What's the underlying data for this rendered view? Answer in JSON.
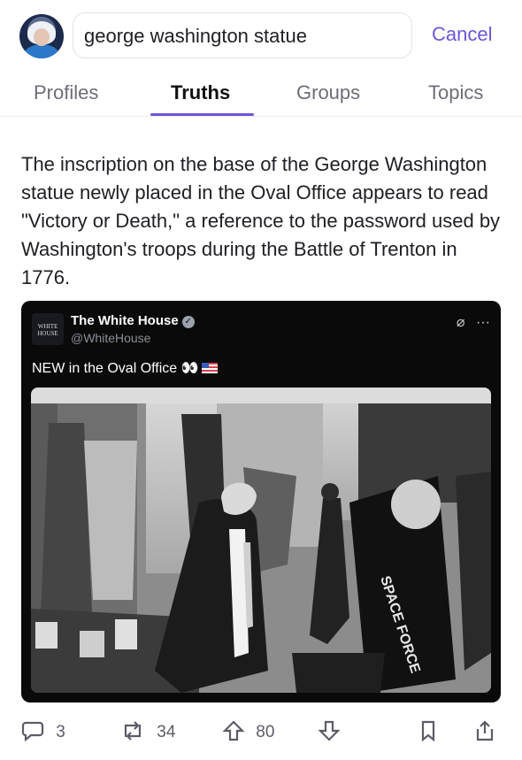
{
  "search": {
    "value": "george washington statue",
    "cancel_label": "Cancel"
  },
  "tabs": [
    {
      "label": "Profiles",
      "active": false
    },
    {
      "label": "Truths",
      "active": true
    },
    {
      "label": "Groups",
      "active": false
    },
    {
      "label": "Topics",
      "active": false
    }
  ],
  "post": {
    "text": "The inscription on the base of the George Washington statue newly placed in the Oval Office appears to read \"Victory or Death,\" a reference to the password used by Washington's troops during the Battle of Trenton in 1776.",
    "embed": {
      "logo_text": "WHITE HOUSE",
      "author_name": "The White House",
      "handle": "@WhiteHouse",
      "text": "NEW in the Oval Office",
      "emoji": "👀",
      "image_flag_text": "SPACE FORCE"
    }
  },
  "actions": {
    "replies": "3",
    "retruths": "34",
    "upvotes": "80"
  },
  "colors": {
    "accent": "#6b57d6",
    "embed_bg": "#0a0a0b"
  },
  "icons": [
    "avatar",
    "verified-badge-icon",
    "edit-icon",
    "more-icon",
    "reply-icon",
    "retruth-icon",
    "upvote-icon",
    "downvote-icon",
    "bookmark-icon",
    "share-icon"
  ]
}
